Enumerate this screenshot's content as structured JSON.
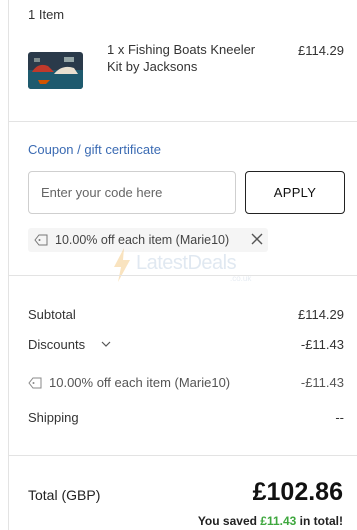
{
  "cart": {
    "count_label": "1 Item",
    "items": [
      {
        "name": "1 x Fishing Boats Kneeler Kit by Jacksons",
        "price": "£114.29",
        "thumb_colors": {
          "bg": "#2a3a4a",
          "sea": "#1e5a6e",
          "boat": "#c0392b"
        }
      }
    ]
  },
  "coupon": {
    "title": "Coupon / gift certificate",
    "placeholder": "Enter your code here",
    "apply_label": "APPLY",
    "applied_chip": "10.00% off each item (Marie10)"
  },
  "watermark": {
    "text": "LatestDeals",
    "sub": ".co.uk"
  },
  "summary": {
    "subtotal_label": "Subtotal",
    "subtotal_value": "£114.29",
    "discounts_label": "Discounts",
    "discounts_value": "-£11.43",
    "discount_line_label": "10.00% off each item (Marie10)",
    "discount_line_value": "-£11.43",
    "shipping_label": "Shipping",
    "shipping_value": "--"
  },
  "total": {
    "label": "Total (GBP)",
    "value": "£102.86",
    "saved_prefix": "You saved ",
    "saved_amount": "£11.43",
    "saved_suffix": " in total!"
  },
  "colors": {
    "link_blue": "#3b6bb3",
    "saved_green": "#3ea73e",
    "divider": "#e3e3e3"
  }
}
